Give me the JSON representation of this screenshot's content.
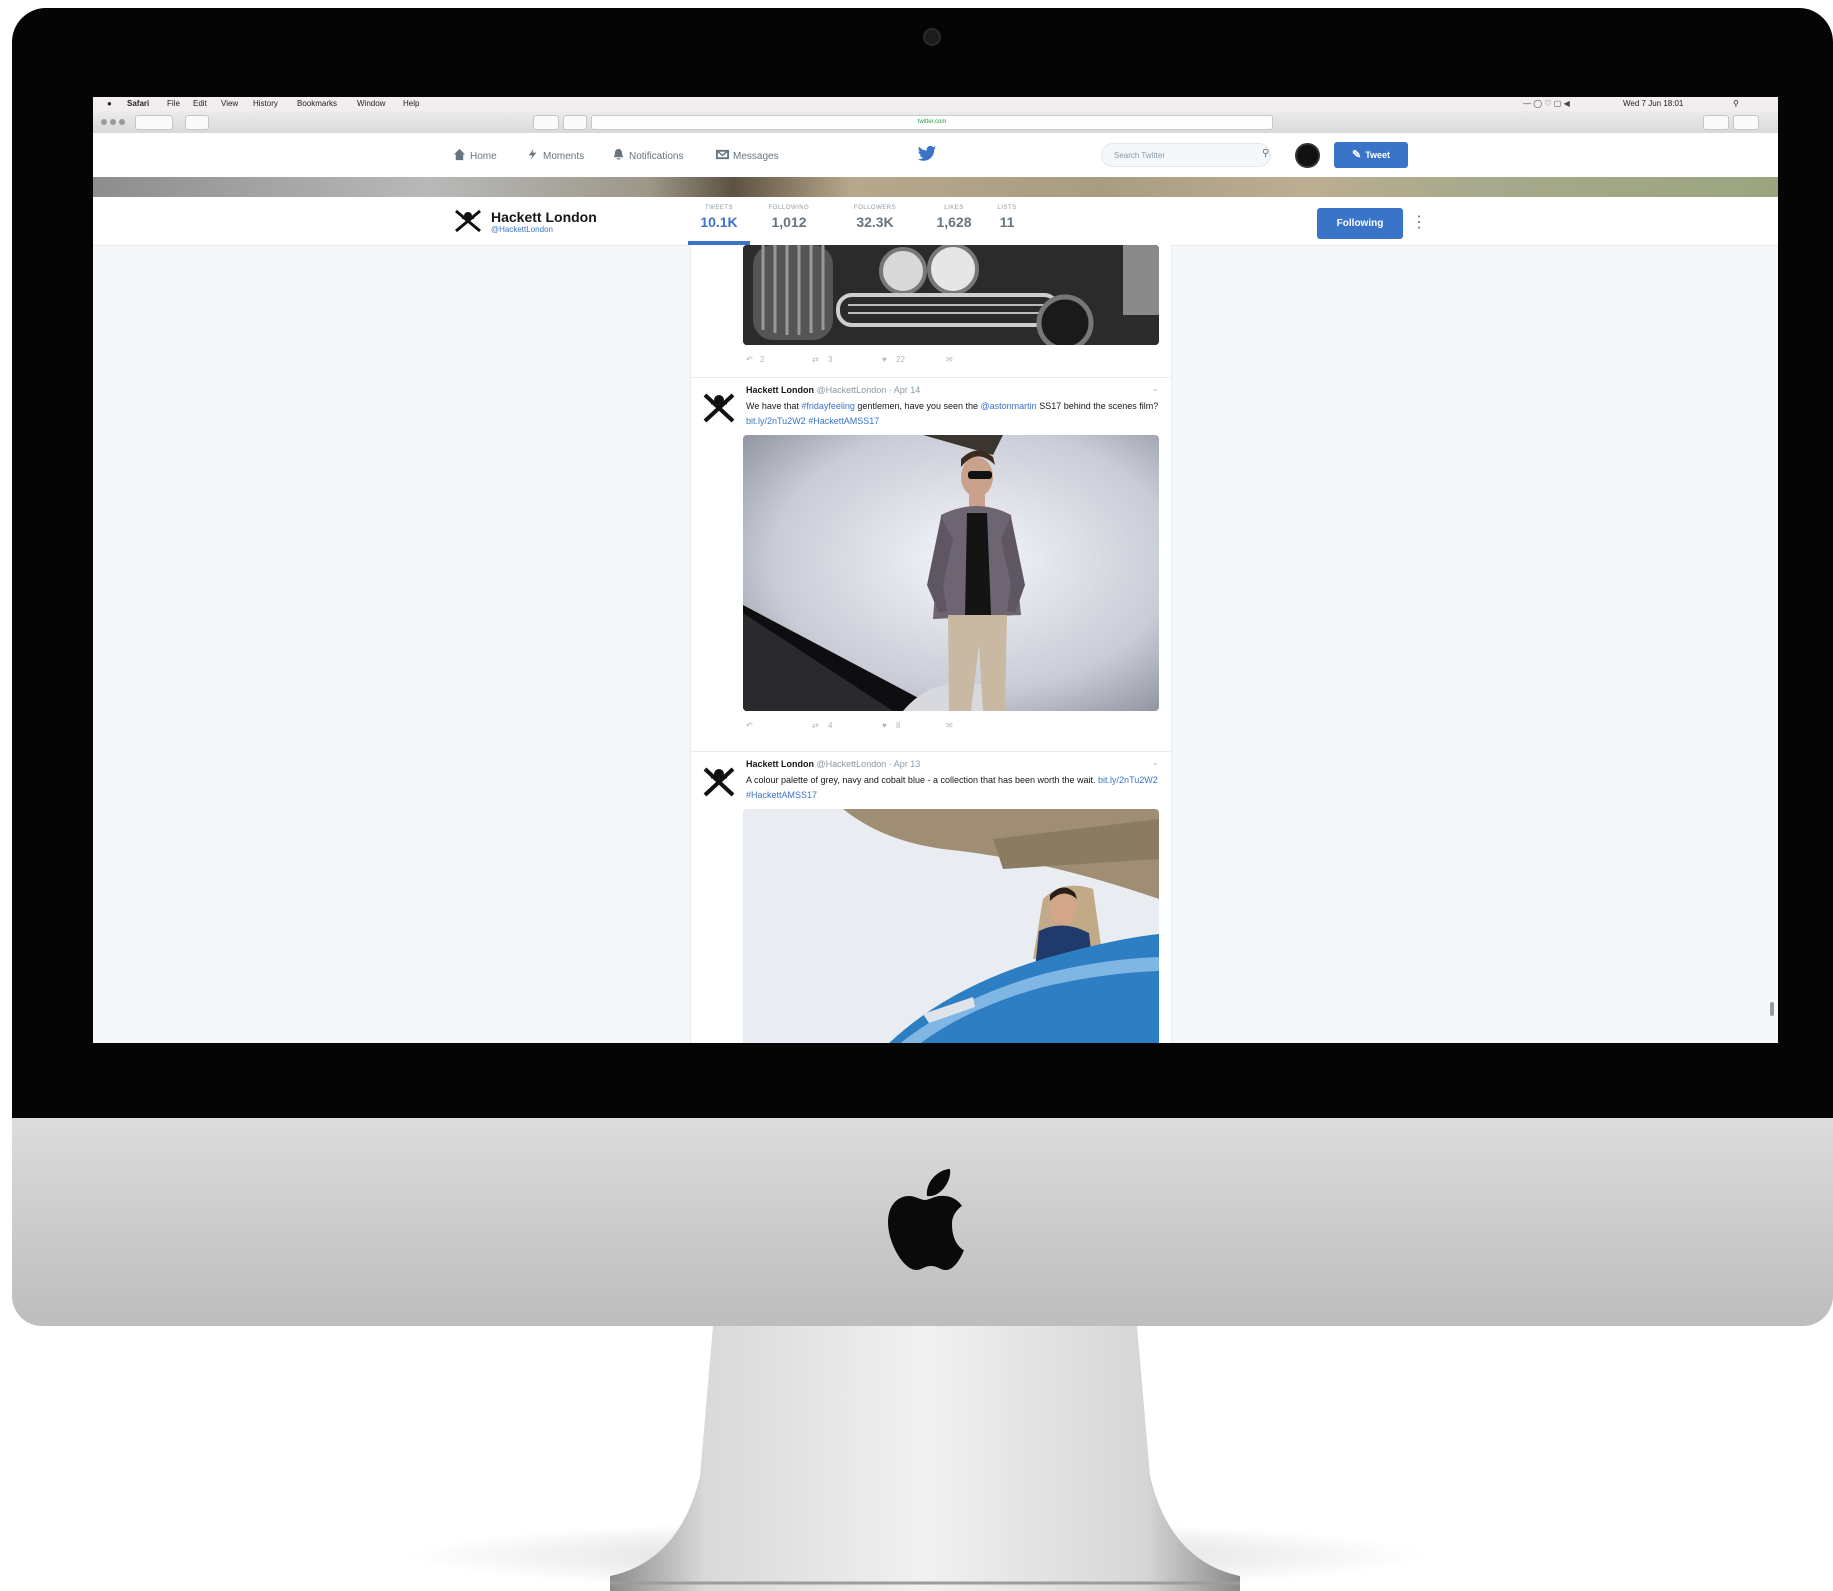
{
  "mac_menu": {
    "app": "Safari",
    "items": [
      "File",
      "Edit",
      "View",
      "History",
      "Bookmarks",
      "Window",
      "Help"
    ],
    "clock": "Wed 7 Jun 18:01"
  },
  "safari": {
    "address": "twitter.com"
  },
  "twitter_nav": {
    "items": [
      {
        "label": "Home",
        "icon": "home-icon"
      },
      {
        "label": "Moments",
        "icon": "lightning-icon"
      },
      {
        "label": "Notifications",
        "icon": "bell-icon"
      },
      {
        "label": "Messages",
        "icon": "envelope-icon"
      }
    ],
    "search_placeholder": "Search Twitter",
    "tweet_button": "Tweet"
  },
  "profile": {
    "name": "Hackett London",
    "handle": "@HackettLondon",
    "stats": [
      {
        "label": "TWEETS",
        "value": "10.1K",
        "active": true
      },
      {
        "label": "FOLLOWING",
        "value": "1,012"
      },
      {
        "label": "FOLLOWERS",
        "value": "32.3K"
      },
      {
        "label": "LIKES",
        "value": "1,628"
      },
      {
        "label": "LISTS",
        "value": "11"
      }
    ],
    "follow_button": "Following"
  },
  "tweets": [
    {
      "actions": {
        "reply": "2",
        "retweet": "3",
        "like": "22"
      }
    },
    {
      "name": "Hackett London",
      "handle": "@HackettLondon",
      "date": "· Apr 14",
      "text_parts": [
        {
          "t": "We have that "
        },
        {
          "t": "#fridayfeeling",
          "link": true
        },
        {
          "t": " gentlemen, have you seen the "
        },
        {
          "t": "@astonmartin",
          "link": true
        },
        {
          "t": " SS17 behind the scenes film? "
        },
        {
          "t": "bit.ly/2nTu2W2",
          "link": true
        },
        {
          "t": " "
        },
        {
          "t": "#HackettAMSS17",
          "link": true
        }
      ],
      "actions": {
        "reply": "",
        "retweet": "4",
        "like": "8"
      }
    },
    {
      "name": "Hackett London",
      "handle": "@HackettLondon",
      "date": "· Apr 13",
      "text_parts": [
        {
          "t": "A colour palette of grey, navy and cobalt blue - a collection that has been worth the wait. "
        },
        {
          "t": "bit.ly/2nTu2W2",
          "link": true
        },
        {
          "t": " "
        },
        {
          "t": "#HackettAMSS17",
          "link": true
        }
      ]
    }
  ],
  "colors": {
    "twitter_blue": "#3a74c9",
    "link": "#3a74c9",
    "page_bg": "#f5f8fa"
  }
}
